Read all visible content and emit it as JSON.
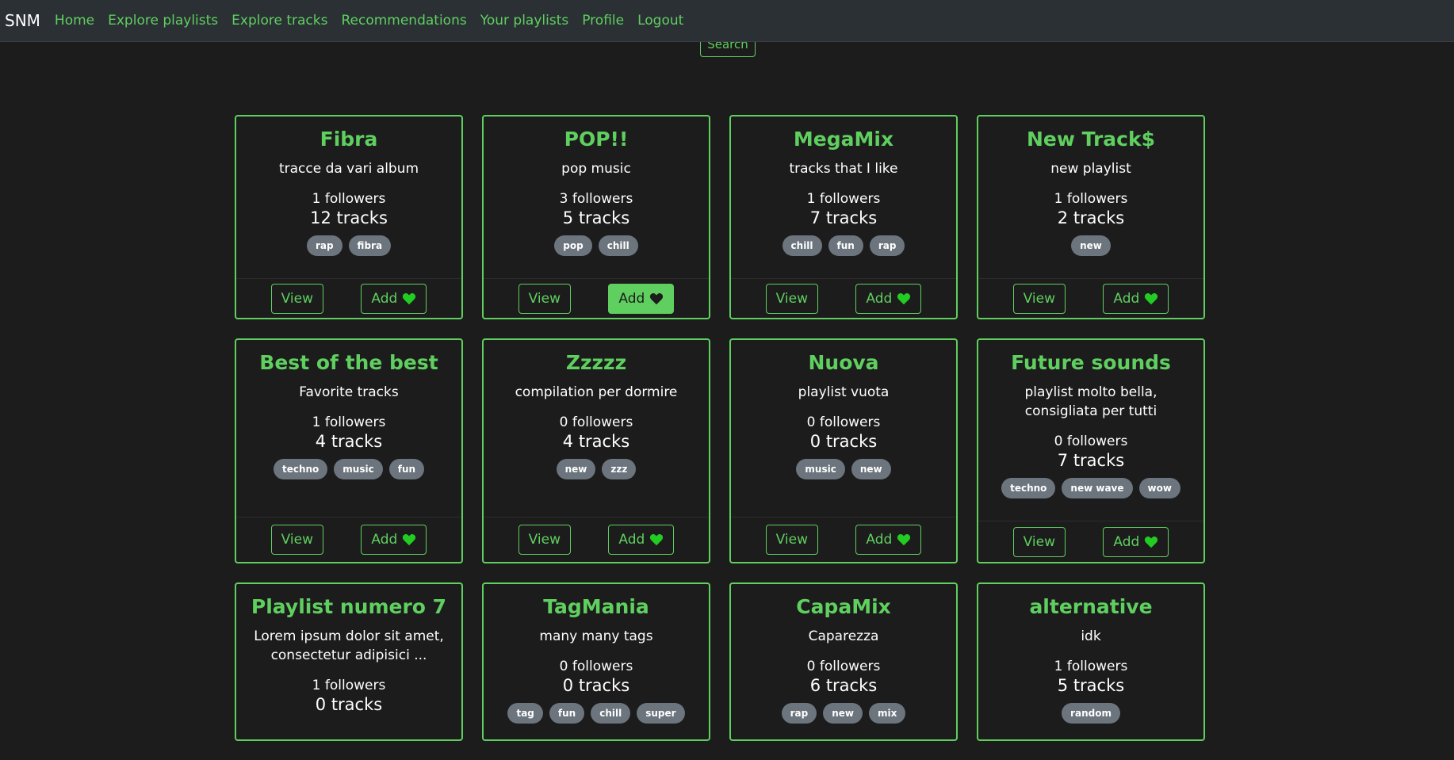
{
  "nav": {
    "brand": "SNM",
    "links": [
      "Home",
      "Explore playlists",
      "Explore tracks",
      "Recommendations",
      "Your playlists",
      "Profile",
      "Logout"
    ]
  },
  "search_label": "Search",
  "buttons": {
    "view": "View",
    "add": "Add"
  },
  "colors": {
    "accent": "#5fcf5f",
    "heart": "#22cc22",
    "tag_bg": "#6c757d",
    "background": "#1c1c1c",
    "navbar": "#2b3035"
  },
  "playlists": [
    {
      "title": "Fibra",
      "description": "tracce da vari album",
      "followers": "1 followers",
      "tracks": "12 tracks",
      "tags": [
        "rap",
        "fibra"
      ],
      "added": false
    },
    {
      "title": "POP!!",
      "description": "pop music",
      "followers": "3 followers",
      "tracks": "5 tracks",
      "tags": [
        "pop",
        "chill"
      ],
      "added": true
    },
    {
      "title": "MegaMix",
      "description": "tracks that I like",
      "followers": "1 followers",
      "tracks": "7 tracks",
      "tags": [
        "chill",
        "fun",
        "rap"
      ],
      "added": false
    },
    {
      "title": "New Track$",
      "description": "new playlist",
      "followers": "1 followers",
      "tracks": "2 tracks",
      "tags": [
        "new"
      ],
      "added": false
    },
    {
      "title": "Best of the best",
      "description": "Favorite tracks",
      "followers": "1 followers",
      "tracks": "4 tracks",
      "tags": [
        "techno",
        "music",
        "fun"
      ],
      "added": false
    },
    {
      "title": "Zzzzz",
      "description": "compilation per dormire",
      "followers": "0 followers",
      "tracks": "4 tracks",
      "tags": [
        "new",
        "zzz"
      ],
      "added": false
    },
    {
      "title": "Nuova",
      "description": "playlist vuota",
      "followers": "0 followers",
      "tracks": "0 tracks",
      "tags": [
        "music",
        "new"
      ],
      "added": false
    },
    {
      "title": "Future sounds",
      "description": "playlist molto bella, consigliata per tutti",
      "followers": "0 followers",
      "tracks": "7 tracks",
      "tags": [
        "techno",
        "new wave",
        "wow"
      ],
      "added": false
    },
    {
      "title": "Playlist numero 7",
      "description": "Lorem ipsum dolor sit amet, consectetur adipisici ...",
      "followers": "1 followers",
      "tracks": "0 tracks",
      "tags": [],
      "added": false
    },
    {
      "title": "TagMania",
      "description": "many many tags",
      "followers": "0 followers",
      "tracks": "0 tracks",
      "tags": [
        "tag",
        "fun",
        "chill",
        "super"
      ],
      "added": false
    },
    {
      "title": "CapaMix",
      "description": "Caparezza",
      "followers": "0 followers",
      "tracks": "6 tracks",
      "tags": [
        "rap",
        "new",
        "mix"
      ],
      "added": false
    },
    {
      "title": "alternative",
      "description": "idk",
      "followers": "1 followers",
      "tracks": "5 tracks",
      "tags": [
        "random"
      ],
      "added": false
    }
  ]
}
